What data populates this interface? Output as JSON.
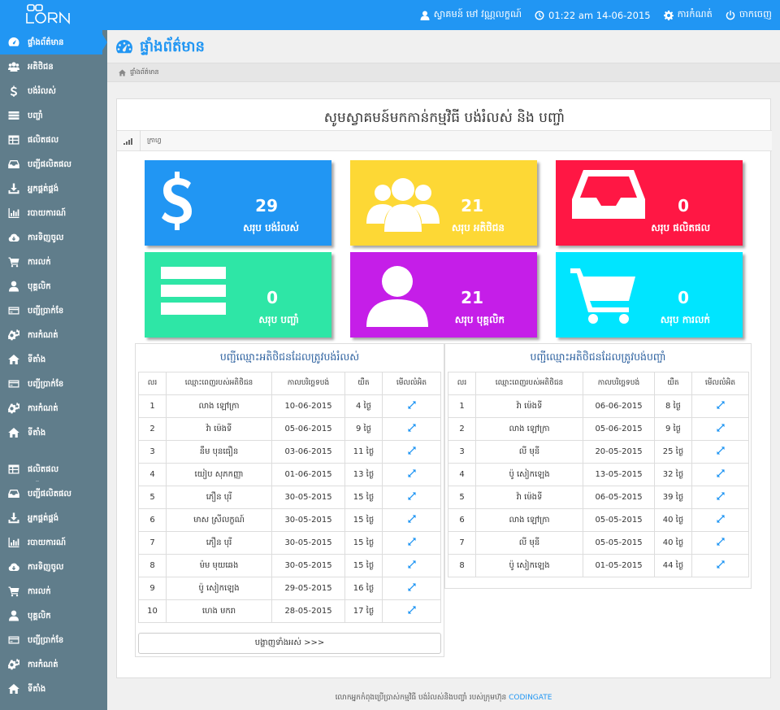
{
  "app": {
    "logo_text": "LOAN"
  },
  "topnav": {
    "user": "ស្វាគមន៍ មៅ វណ្ណលក្ខណ៍",
    "time": "01:22 am 14-06-2015",
    "settings": "ការកំណត់",
    "logout": "ចាកចេញ"
  },
  "sidebar": {
    "items": [
      {
        "label": "ផ្ទាំងព័ត៌មាន",
        "icon": "dashboard-icon"
      },
      {
        "label": "អតិថិជន",
        "icon": "users-icon"
      },
      {
        "label": "បង់រំលស់",
        "icon": "dollar-icon"
      },
      {
        "label": "បញ្ចាំ",
        "icon": "list-icon"
      },
      {
        "label": "ផលិតផល",
        "icon": "table-icon"
      },
      {
        "label": "បញ្ជីផលិតផល",
        "icon": "inbox-icon"
      },
      {
        "label": "អ្នកផ្គត់ផ្គង់",
        "icon": "download-icon"
      },
      {
        "label": "របាយការណ៍",
        "icon": "chart-icon"
      },
      {
        "label": "ការទិញចូល",
        "icon": "cloud-icon"
      },
      {
        "label": "ការលក់",
        "icon": "cart-icon"
      },
      {
        "label": "បុគ្គលិក",
        "icon": "user-icon"
      },
      {
        "label": "បញ្ជីប្រាក់ខែ",
        "icon": "credit-card-icon"
      },
      {
        "label": "ការកំណត់",
        "icon": "cogs-icon"
      },
      {
        "label": "ទីតាំង",
        "icon": "home-icon"
      },
      {
        "label": "បញ្ជីប្រាក់ខែ",
        "icon": "credit-card-icon"
      },
      {
        "label": "ការកំណត់",
        "icon": "cogs-icon"
      },
      {
        "label": "ទីតាំង",
        "icon": "home-icon"
      },
      {
        "label": "ផលិតផល",
        "icon": "table-icon"
      },
      {
        "label": "បញ្ជីផលិតផល",
        "icon": "inbox-icon"
      },
      {
        "label": "អ្នកផ្គត់ផ្គង់",
        "icon": "download-icon"
      },
      {
        "label": "របាយការណ៍",
        "icon": "chart-icon"
      },
      {
        "label": "ការទិញចូល",
        "icon": "cloud-icon"
      },
      {
        "label": "ការលក់",
        "icon": "cart-icon"
      },
      {
        "label": "បុគ្គលិក",
        "icon": "user-icon"
      },
      {
        "label": "បញ្ជីប្រាក់ខែ",
        "icon": "credit-card-icon"
      },
      {
        "label": "ការកំណត់",
        "icon": "cogs-icon"
      },
      {
        "label": "ទីតាំង",
        "icon": "home-icon"
      }
    ]
  },
  "page": {
    "title": "ផ្ទាំងព័ត៌មាន",
    "breadcrumb": "ផ្ទាំងព័ត៌មាន",
    "welcome": "សូមស្វាគមន៍មកកាន់កម្មវិធី បង់រំលស់ និង បញ្ចាំ",
    "panel_label": "ក្រាហ្វ"
  },
  "tiles": [
    {
      "value": "29",
      "label": "សរុប បង់រំលស់",
      "color": "#2196f3",
      "icon": "dollar-icon"
    },
    {
      "value": "21",
      "label": "សរុប អតិថិជន",
      "color": "#fdd835",
      "icon": "users-icon"
    },
    {
      "value": "0",
      "label": "សរុប ផលិតផល",
      "color": "#ff1744",
      "icon": "inbox-icon"
    },
    {
      "value": "0",
      "label": "សរុប បញ្ចាំ",
      "color": "#2ee6a6",
      "icon": "server-icon"
    },
    {
      "value": "21",
      "label": "សរុប បុគ្គលិក",
      "color": "#c51ee8",
      "icon": "user-icon"
    },
    {
      "value": "0",
      "label": "សរុប ការលក់",
      "color": "#00e5ff",
      "icon": "cart-icon"
    }
  ],
  "installment_table": {
    "title": "បញ្ជីឈ្មោះអតិថិជនដែលត្រូវបង់រំលស់",
    "headers": [
      "លរ",
      "ឈ្មោះពេញរបស់អតិថិជន",
      "កាលបរិច្ឆេទបង់",
      "យឺត",
      "មើលលំអិត"
    ],
    "rows": [
      [
        "1",
        "លាង ឡៅក្រា",
        "10-06-2015",
        "4 ថ្ងៃ"
      ],
      [
        "2",
        "វ៉ា ម៉េងទី",
        "05-06-2015",
        "9 ថ្ងៃ"
      ],
      [
        "3",
        "នឹម បុនធឿន",
        "03-06-2015",
        "11 ថ្ងៃ"
      ],
      [
        "4",
        "យៀប សុភកញ្ញា",
        "01-06-2015",
        "13 ថ្ងៃ"
      ],
      [
        "5",
        "ភឿន បុរី",
        "30-05-2015",
        "15 ថ្ងៃ"
      ],
      [
        "6",
        "មាស ស្រីលក្ខណ៍",
        "30-05-2015",
        "15 ថ្ងៃ"
      ],
      [
        "7",
        "ភឿន បុរី",
        "30-05-2015",
        "15 ថ្ងៃ"
      ],
      [
        "8",
        "ម៉ម មុយឆេង",
        "30-05-2015",
        "15 ថ្ងៃ"
      ],
      [
        "9",
        "ប៉ូ សៀកឡេង",
        "29-05-2015",
        "16 ថ្ងៃ"
      ],
      [
        "10",
        "ហេង មករា",
        "28-05-2015",
        "17 ថ្ងៃ"
      ]
    ],
    "view_all": "បង្ហាញទាំងអស់ >>>"
  },
  "pawn_table": {
    "title": "បញ្ជីឈ្មោះអតិថិជនដែលត្រូវបង់បញ្ចាំ",
    "headers": [
      "លរ",
      "ឈ្មោះពេញរបស់អតិថិជន",
      "កាលបរិច្ឆេទបង់",
      "យឺត",
      "មើលលំអិត"
    ],
    "rows": [
      [
        "1",
        "វ៉ា ម៉េងទី",
        "06-06-2015",
        "8 ថ្ងៃ"
      ],
      [
        "2",
        "លាង ឡៅក្រា",
        "05-06-2015",
        "9 ថ្ងៃ"
      ],
      [
        "3",
        "លី មុនី",
        "20-05-2015",
        "25 ថ្ងៃ"
      ],
      [
        "4",
        "ប៉ូ សៀកឡេង",
        "13-05-2015",
        "32 ថ្ងៃ"
      ],
      [
        "5",
        "វ៉ា ម៉េងទី",
        "06-05-2015",
        "39 ថ្ងៃ"
      ],
      [
        "6",
        "លាង ឡៅក្រា",
        "05-05-2015",
        "40 ថ្ងៃ"
      ],
      [
        "7",
        "លី មុនី",
        "05-05-2015",
        "40 ថ្ងៃ"
      ],
      [
        "8",
        "ប៉ូ សៀកឡេង",
        "01-05-2015",
        "44 ថ្ងៃ"
      ]
    ]
  },
  "footer": {
    "text": "លោកអ្នកកំពុងប្រើប្រាស់កម្មវិធី បង់រំលស់និងបញ្ចាំ របស់ក្រុមហ៊ុន",
    "brand": "CODINGATE"
  }
}
